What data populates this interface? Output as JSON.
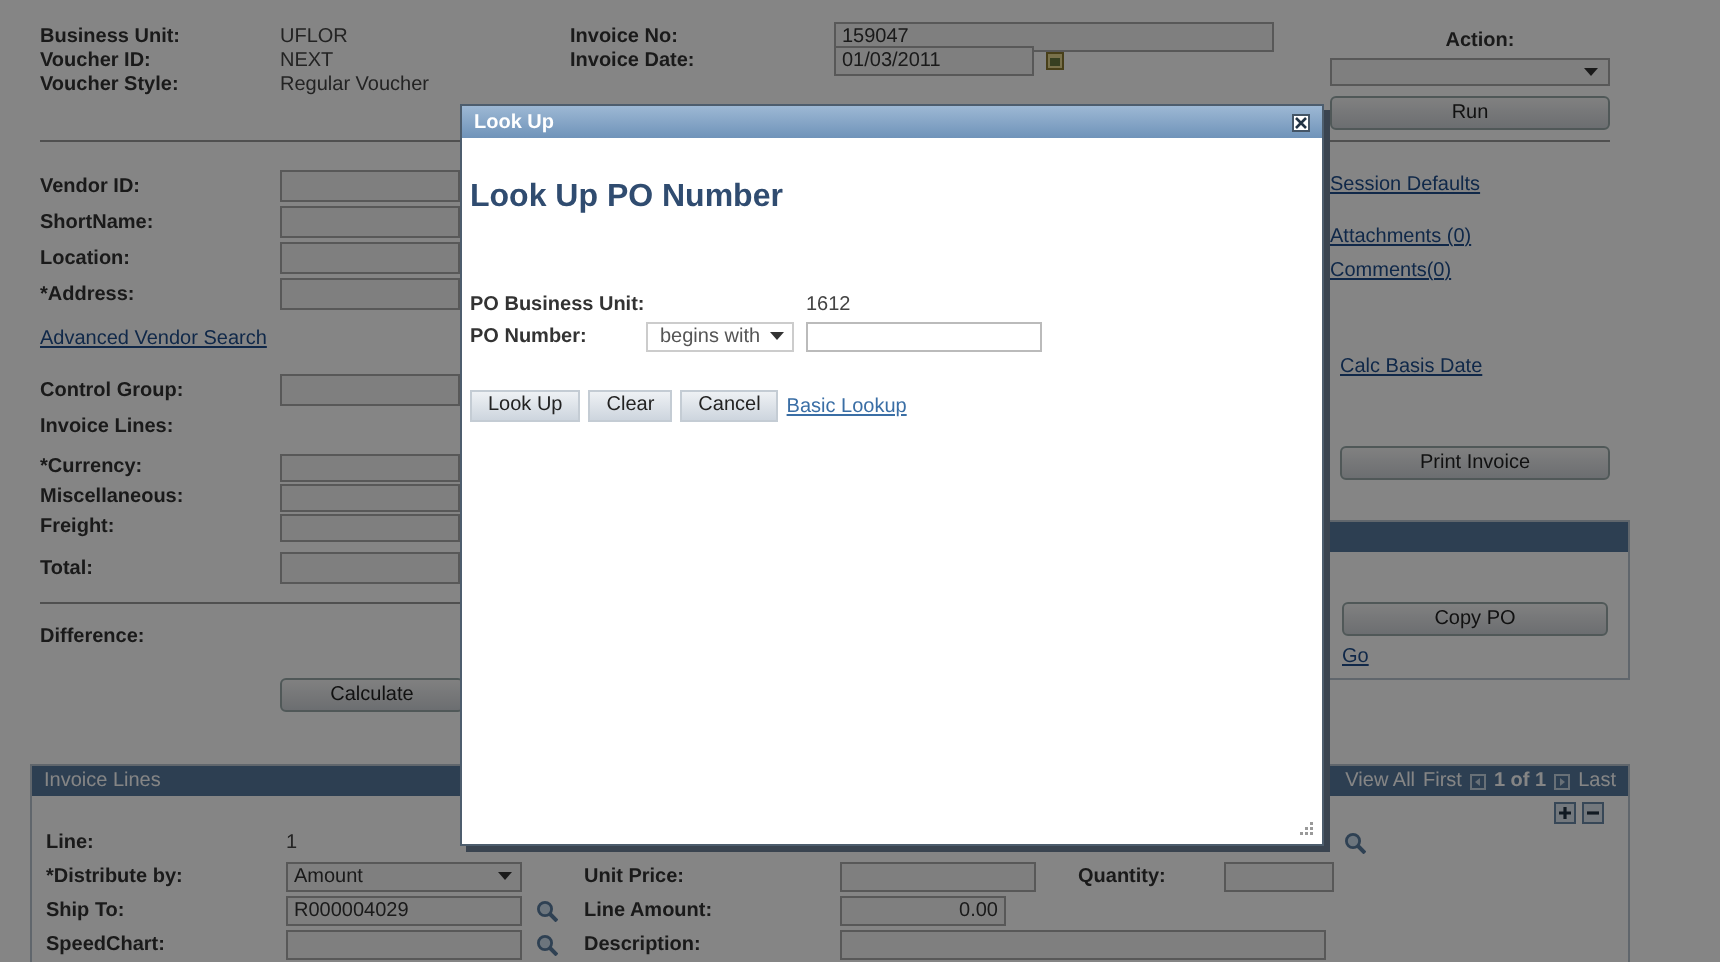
{
  "summary": [
    {
      "label": "Business Unit:",
      "value": "UFLOR"
    },
    {
      "label": "Voucher ID:",
      "value": "NEXT"
    },
    {
      "label": "Voucher Style:",
      "value": "Regular Voucher"
    }
  ],
  "invoice": [
    {
      "label": "Invoice No:",
      "value": "159047",
      "kind": "text"
    },
    {
      "label": "Invoice Date:",
      "value": "01/03/2011",
      "kind": "date"
    }
  ],
  "vendor_fields": [
    {
      "label": "Vendor ID:"
    },
    {
      "label": "ShortName:"
    },
    {
      "label": "Location:"
    },
    {
      "label": "*Address:"
    }
  ],
  "advanced_link": "Advanced Vendor Search",
  "control_fields": [
    {
      "label": "Control Group:",
      "kind": "field"
    },
    {
      "label": "Invoice Lines:",
      "kind": "plain"
    }
  ],
  "amount_fields": [
    {
      "label": "*Currency:"
    },
    {
      "label": "Miscellaneous:"
    },
    {
      "label": "Freight:"
    },
    {
      "label": "Total:"
    }
  ],
  "difference_label": "Difference:",
  "calculate_button": "Calculate",
  "action": {
    "label": "Action:",
    "button": "Run"
  },
  "links": [
    "Session Defaults",
    "Attachments (0)",
    "Comments(0)"
  ],
  "calc_basis_link": "Calc Basis Date",
  "print_button": "Print Invoice",
  "copy_po": {
    "button": "Copy PO",
    "link": "Go"
  },
  "invoice_lines": {
    "title": "Invoice Lines",
    "nav": {
      "view_all": "View All",
      "first": "First",
      "counter": "1 of 1",
      "last": "Last"
    },
    "line": {
      "label": "Line:",
      "value": "1"
    },
    "distribute": {
      "label": "*Distribute by:",
      "value": "Amount"
    },
    "ship_to": {
      "label": "Ship To:",
      "value": "R000004029"
    },
    "speedchart": {
      "label": "SpeedChart:"
    },
    "unit_price": "Unit Price:",
    "quantity": "Quantity:",
    "line_amount": {
      "label": "Line Amount:",
      "value": "0.00"
    },
    "description": "Description:"
  },
  "dialog": {
    "title": "Look Up",
    "heading": "Look Up PO Number",
    "business_unit": {
      "label": "PO Business Unit:",
      "value": "1612"
    },
    "po_number": {
      "label": "PO Number:",
      "operator": "begins with"
    },
    "buttons": [
      "Look Up",
      "Clear",
      "Cancel"
    ],
    "basic_lookup": "Basic Lookup"
  }
}
